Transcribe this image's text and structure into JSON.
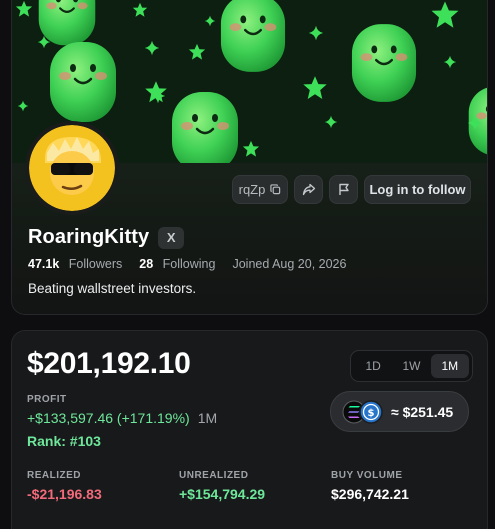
{
  "profile": {
    "short_code": "rqZp",
    "follow_label": "Log in to follow",
    "username": "RoaringKitty",
    "x_badge": "X",
    "followers_count": "47.1k",
    "followers_label": "Followers",
    "following_count": "28",
    "following_label": "Following",
    "joined": "Joined Aug 20, 2026",
    "bio": "Beating wallstreet investors."
  },
  "pnl": {
    "balance": "$201,192.10",
    "ranges": [
      "1D",
      "1W",
      "1M"
    ],
    "active_range": "1M",
    "profit_label": "PROFIT",
    "profit_value": "+$133,597.46 (+171.19%)",
    "profit_period": "1M",
    "rank": "Rank: #103",
    "token_value": "≈ $251.45",
    "tokens": [
      "solana-icon",
      "usdc-icon"
    ],
    "metrics": [
      {
        "label": "REALIZED",
        "value": "-$21,196.83",
        "tone": "red"
      },
      {
        "label": "UNREALIZED",
        "value": "+$154,794.29",
        "tone": "green"
      },
      {
        "label": "BUY VOLUME",
        "value": "$296,742.21",
        "tone": "white"
      }
    ]
  },
  "colors": {
    "positive": "#6ee79a",
    "negative": "#f36a7a",
    "banner_bg": "#0c1f10",
    "mascot": "#3fd155"
  }
}
